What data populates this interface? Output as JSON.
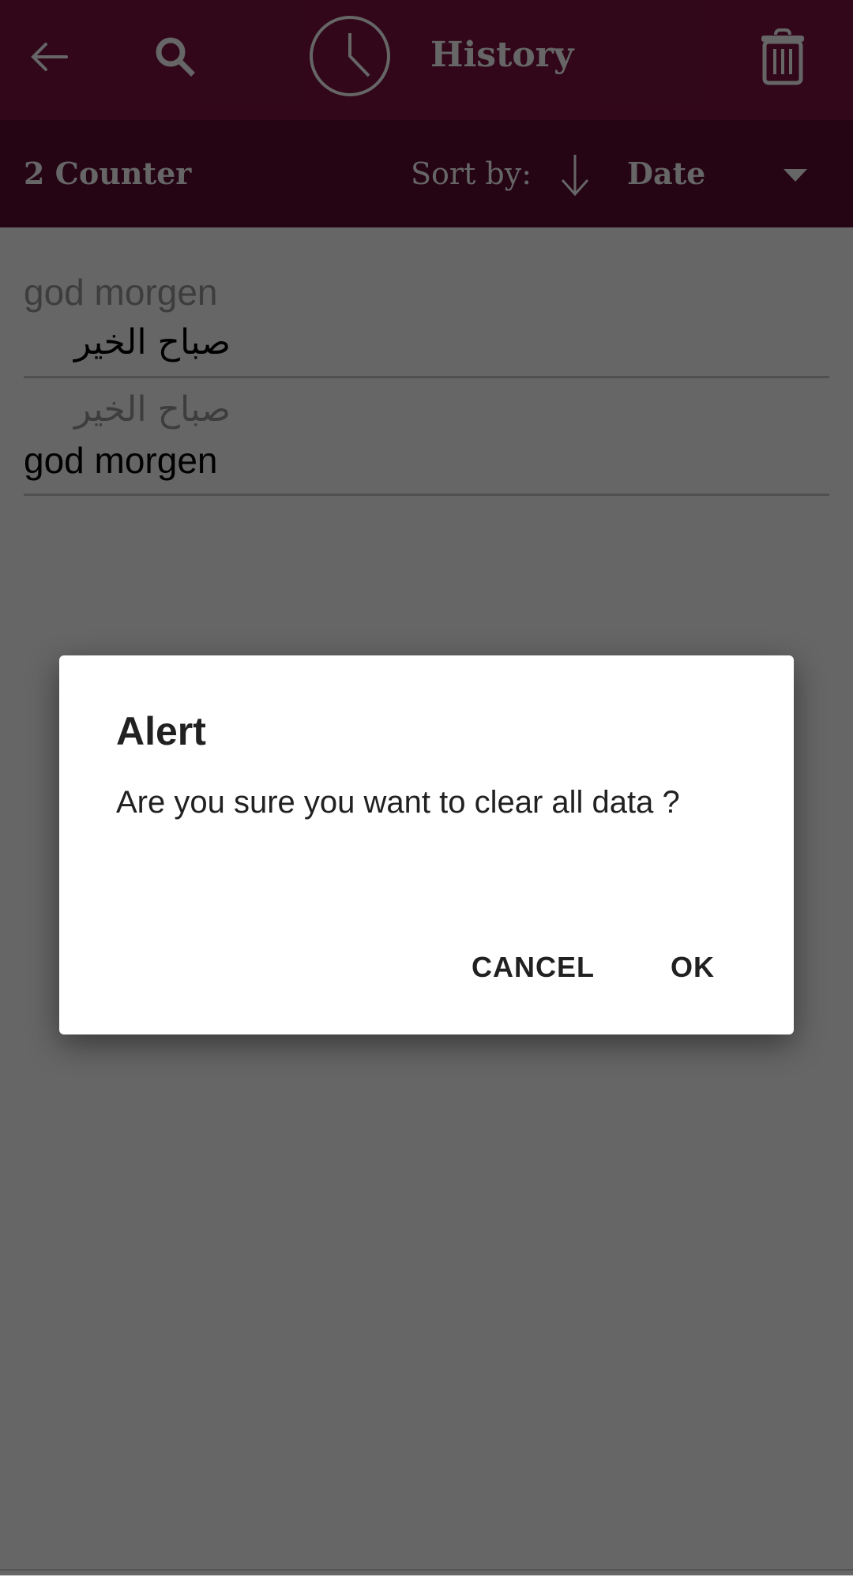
{
  "app_bar": {
    "title": "History",
    "back_icon": "arrow-left-icon",
    "search_icon": "search-icon",
    "history_icon": "clock-icon",
    "delete_icon": "trash-icon",
    "background_color": "#7a1240"
  },
  "sub_bar": {
    "counter_label": "2 Counter",
    "sort_label": "Sort by:",
    "sort_direction_icon": "arrow-down-icon",
    "sort_value": "Date",
    "dropdown_icon": "caret-down-icon",
    "background_color": "#5e0b30"
  },
  "history": {
    "items": [
      {
        "source": "god morgen",
        "translation": "صباح الخير",
        "source_lang": "en",
        "translation_lang": "ar"
      },
      {
        "source": "صباح الخير",
        "translation": "god morgen",
        "source_lang": "ar",
        "translation_lang": "en"
      }
    ]
  },
  "dialog": {
    "title": "Alert",
    "message": "Are you sure you want to clear all data ?",
    "cancel_label": "CANCEL",
    "ok_label": "OK"
  }
}
